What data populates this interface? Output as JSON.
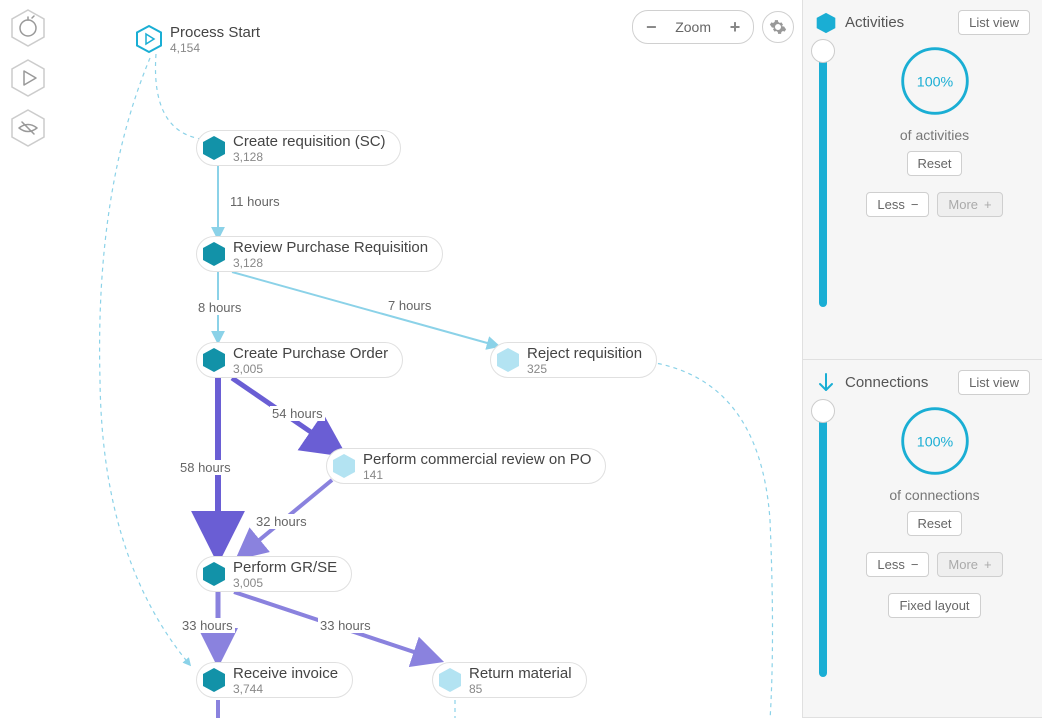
{
  "zoom": {
    "label": "Zoom"
  },
  "start": {
    "label": "Process Start",
    "count": "4,154"
  },
  "nodes": {
    "create_req": {
      "label": "Create requisition (SC)",
      "count": "3,128"
    },
    "review_req": {
      "label": "Review Purchase Requisition",
      "count": "3,128"
    },
    "create_po": {
      "label": "Create Purchase Order",
      "count": "3,005"
    },
    "reject_req": {
      "label": "Reject requisition",
      "count": "325"
    },
    "comm_review": {
      "label": "Perform commercial review on PO",
      "count": "141"
    },
    "perform_gr": {
      "label": "Perform GR/SE",
      "count": "3,005"
    },
    "receive_inv": {
      "label": "Receive invoice",
      "count": "3,744"
    },
    "return_mat": {
      "label": "Return material",
      "count": "85"
    }
  },
  "edges": {
    "cr_to_rr": "11 hours",
    "rr_to_cpo": "8 hours",
    "rr_to_rej": "7 hours",
    "cpo_to_cr": "54 hours",
    "cpo_to_gr": "58 hours",
    "cr_to_gr": "32 hours",
    "gr_to_inv": "33 hours",
    "gr_to_ret": "33 hours"
  },
  "panel": {
    "activities": {
      "title": "Activities",
      "listview": "List view",
      "gauge": "100%",
      "caption": "of activities",
      "reset": "Reset",
      "less": "Less",
      "more": "More"
    },
    "connections": {
      "title": "Connections",
      "listview": "List view",
      "gauge": "100%",
      "caption": "of connections",
      "reset": "Reset",
      "less": "Less",
      "more": "More",
      "fixed": "Fixed layout"
    }
  },
  "colors": {
    "teal": "#1aaed4",
    "purple": "#6a5ed4",
    "light": "#b3e3f2"
  }
}
